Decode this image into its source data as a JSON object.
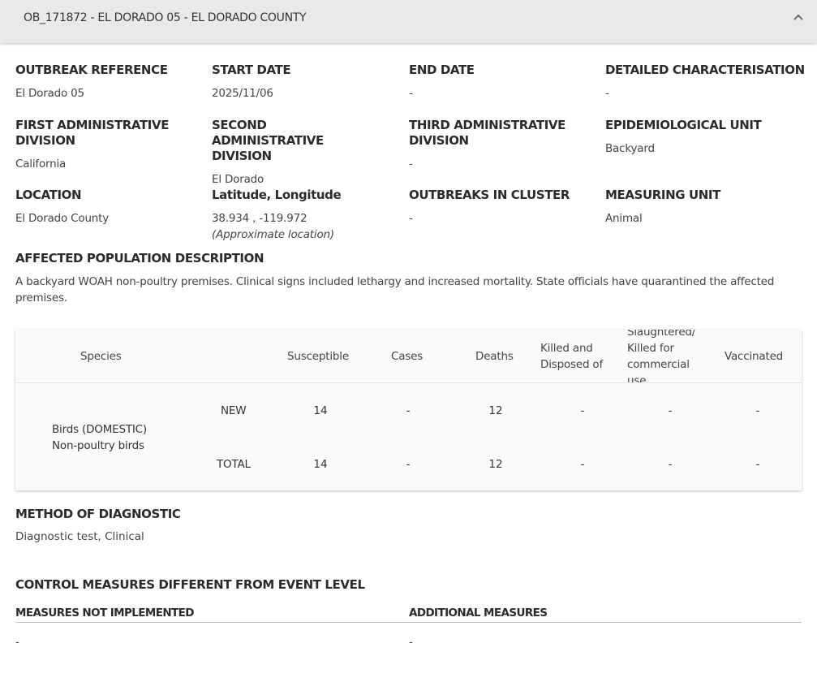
{
  "header": {
    "title": "OB_171872 - EL DORADO 05 - EL DORADO COUNTY",
    "chevron_icon": "chevron-up-icon"
  },
  "fields": {
    "outbreak_reference": {
      "label": "OUTBREAK REFERENCE",
      "value": "El Dorado 05"
    },
    "start_date": {
      "label": "START DATE",
      "value": "2025/11/06"
    },
    "end_date": {
      "label": "END DATE",
      "value": "-"
    },
    "detailed_characterisation": {
      "label": "DETAILED CHARACTERISATION",
      "value": "-"
    },
    "first_admin_division": {
      "label": "FIRST ADMINISTRATIVE DIVISION",
      "value": "California"
    },
    "second_admin_division": {
      "label": "SECOND ADMINISTRATIVE DIVISION",
      "value": "El Dorado"
    },
    "third_admin_division": {
      "label": "THIRD ADMINISTRATIVE DIVISION",
      "value": "-"
    },
    "epidemiological_unit": {
      "label": "EPIDEMIOLOGICAL UNIT",
      "value": "Backyard"
    },
    "location": {
      "label": "LOCATION",
      "value": "El Dorado County"
    },
    "lat_long": {
      "label": "Latitude, Longitude",
      "value": "38.934 , -119.972",
      "note": "(Approximate location)"
    },
    "outbreaks_in_cluster": {
      "label": "OUTBREAKS IN CLUSTER",
      "value": "-"
    },
    "measuring_unit": {
      "label": "MEASURING UNIT",
      "value": "Animal"
    }
  },
  "affected_population": {
    "label": "AFFECTED POPULATION DESCRIPTION",
    "text": "A backyard WOAH non-poultry premises. Clinical signs included lethargy and increased mortality. State officials have quarantined the affected premises."
  },
  "table": {
    "headers": {
      "species": "Species",
      "susceptible": "Susceptible",
      "cases": "Cases",
      "deaths": "Deaths",
      "killed": "Killed and Disposed of",
      "slaughtered": "Slaughtered/ Killed for commercial use",
      "vaccinated": "Vaccinated"
    },
    "species_name": "Birds (DOMESTIC) Non-poultry birds",
    "rows": [
      {
        "label": "NEW",
        "susceptible": "14",
        "cases": "-",
        "deaths": "12",
        "killed": "-",
        "slaughtered": "-",
        "vaccinated": "-"
      },
      {
        "label": "TOTAL",
        "susceptible": "14",
        "cases": "-",
        "deaths": "12",
        "killed": "-",
        "slaughtered": "-",
        "vaccinated": "-"
      }
    ]
  },
  "diagnostic": {
    "label": "METHOD OF DIAGNOSTIC",
    "value": "Diagnostic test, Clinical"
  },
  "control_measures": {
    "label": "CONTROL MEASURES DIFFERENT FROM EVENT LEVEL",
    "not_implemented_label": "MEASURES NOT IMPLEMENTED",
    "not_implemented_value": "-",
    "additional_label": "ADDITIONAL MEASURES",
    "additional_value": "-"
  }
}
